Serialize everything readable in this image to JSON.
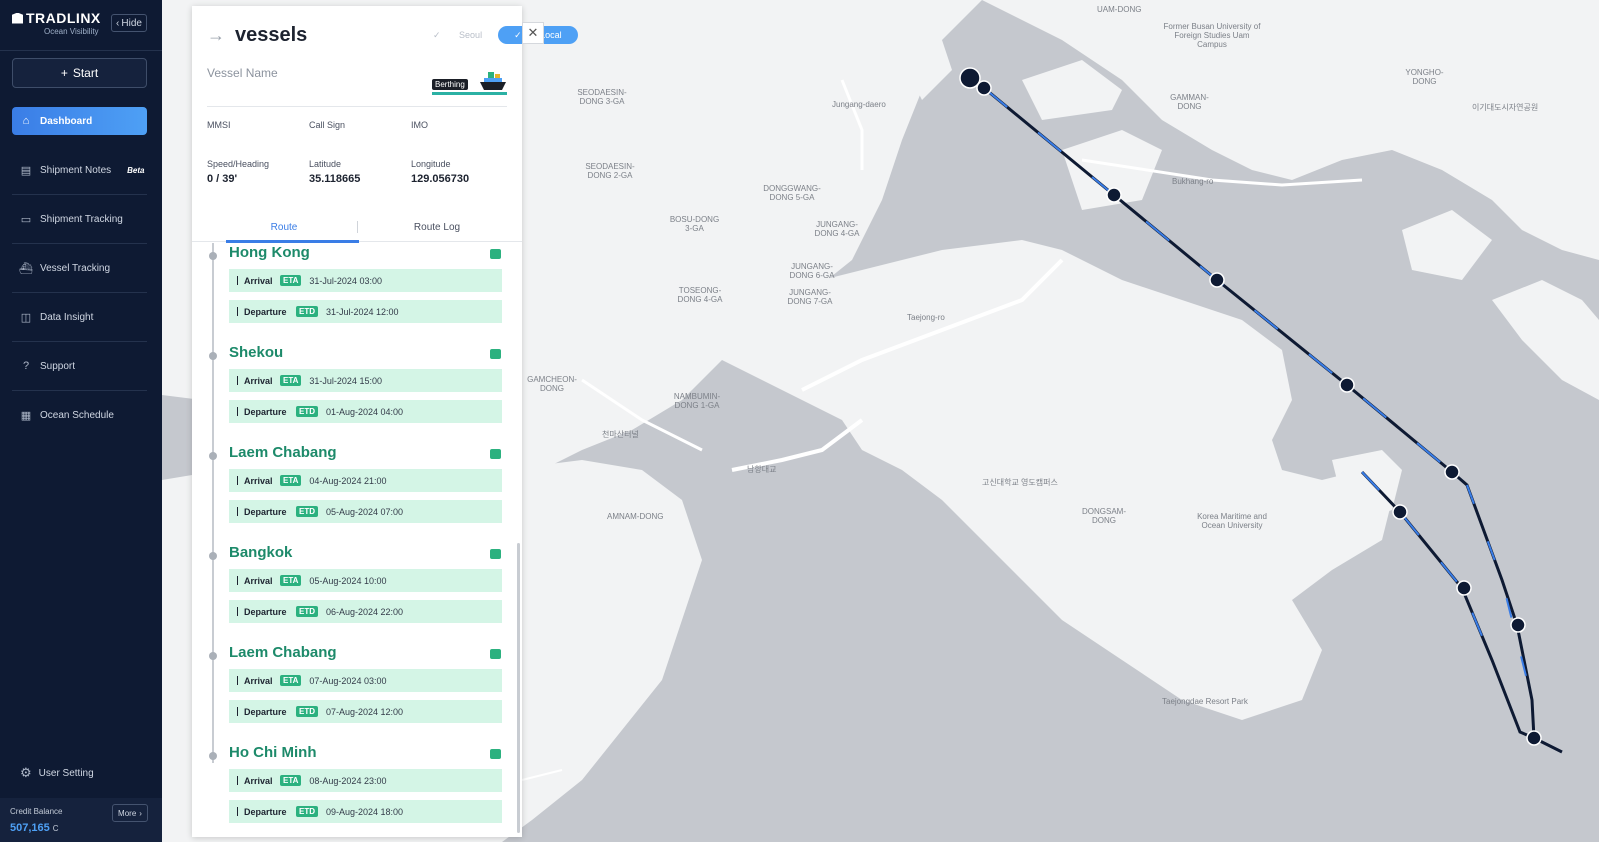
{
  "sidebar": {
    "brand": "TRADLINX",
    "brand_sub": "Ocean Visibility",
    "hide_label": "Hide",
    "start_label": "Start",
    "items": [
      {
        "label": "Dashboard",
        "icon": "home-icon",
        "active": true
      },
      {
        "label": "Shipment Notes",
        "icon": "notes-icon",
        "badge": "Beta"
      },
      {
        "label": "Shipment Tracking",
        "icon": "tracking-icon"
      },
      {
        "label": "Vessel Tracking",
        "icon": "vessel-icon"
      },
      {
        "label": "Data Insight",
        "icon": "chart-icon"
      },
      {
        "label": "Support",
        "icon": "question-icon"
      },
      {
        "label": "Ocean Schedule",
        "icon": "calendar-icon"
      }
    ],
    "user_setting": "User Setting",
    "credit_label": "Credit Balance",
    "credit_value": "507,165",
    "credit_unit": "C",
    "more_label": "More"
  },
  "panel": {
    "title": "vessels",
    "tz_seoul": "Seoul",
    "tz_local": "Local",
    "vessel_name_label": "Vessel Name",
    "status": "Berthing",
    "fields": {
      "mmsi_label": "MMSI",
      "callsign_label": "Call Sign",
      "imo_label": "IMO",
      "speed_label": "Speed/Heading",
      "speed_value": "0 / 39'",
      "lat_label": "Latitude",
      "lat_value": "35.118665",
      "lon_label": "Longitude",
      "lon_value": "129.056730"
    },
    "tabs": {
      "route": "Route",
      "route_log": "Route Log"
    },
    "ports": [
      {
        "name": "Hong Kong",
        "arrival": "31-Jul-2024 03:00",
        "departure": "31-Jul-2024 12:00"
      },
      {
        "name": "Shekou",
        "arrival": "31-Jul-2024 15:00",
        "departure": "01-Aug-2024 04:00"
      },
      {
        "name": "Laem Chabang",
        "arrival": "04-Aug-2024 21:00",
        "departure": "05-Aug-2024 07:00"
      },
      {
        "name": "Bangkok",
        "arrival": "05-Aug-2024 10:00",
        "departure": "06-Aug-2024 22:00"
      },
      {
        "name": "Laem Chabang",
        "arrival": "07-Aug-2024 03:00",
        "departure": "07-Aug-2024 12:00"
      },
      {
        "name": "Ho Chi Minh",
        "arrival": "08-Aug-2024 23:00",
        "departure": "09-Aug-2024 18:00"
      }
    ],
    "arrival_label": "Arrival",
    "departure_label": "Departure",
    "eta_code": "ETA",
    "etd_code": "ETD"
  },
  "map": {
    "labels": [
      "UAM-DONG",
      "Former Busan University of Foreign Studies Uam Campus",
      "SEODAESIN-DONG 3-GA",
      "Jungang-daero",
      "GAMMAN-DONG",
      "YONGHO-DONG",
      "이기대도시자연공원",
      "SEODAESIN-DONG 2-GA",
      "Bukhang-ro",
      "DONGGWANG-DONG 5-GA",
      "BOSU-DONG 3-GA",
      "JUNGANG-DONG 4-GA",
      "JUNGANG-DONG 6-GA",
      "TOSEONG-DONG 4-GA",
      "JUNGANG-DONG 7-GA",
      "Taejong-ro",
      "GAMCHEON-DONG",
      "NAMBUMIN-DONG 1-GA",
      "천마산터널",
      "남항대교",
      "고신대학교 영도캠퍼스",
      "AMNAM-DONG",
      "DONGSAM-DONG",
      "Korea Maritime and Ocean University",
      "Taejongdae Resort Park"
    ]
  }
}
